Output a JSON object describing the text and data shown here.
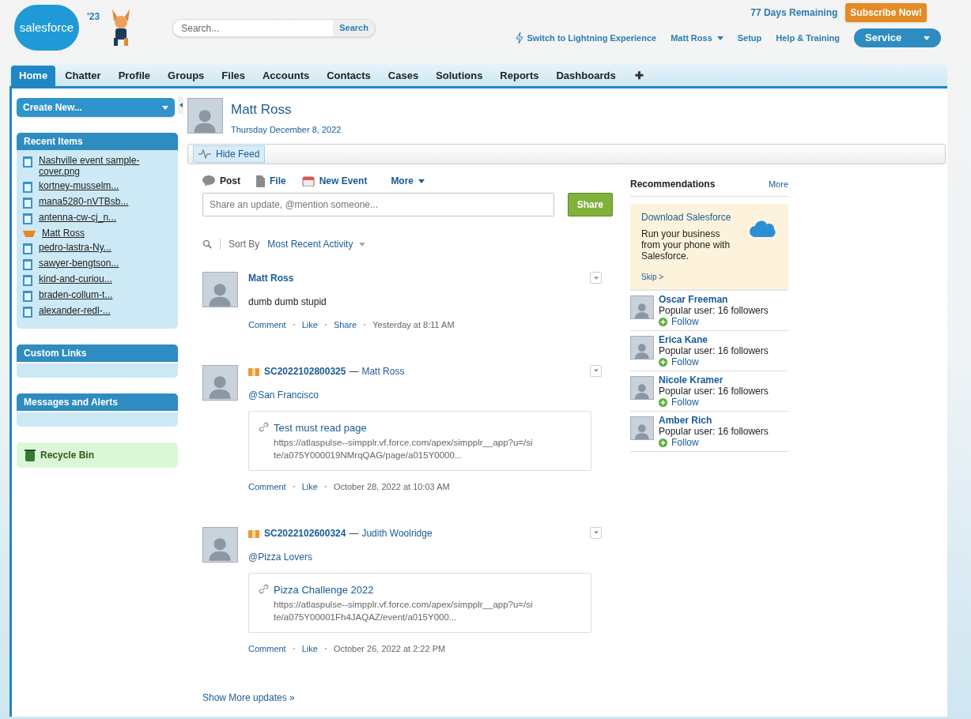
{
  "header": {
    "logo": "salesforce",
    "year": "'23",
    "search_placeholder": "Search...",
    "search_button": "Search",
    "trial": "77 Days Remaining",
    "subscribe": "Subscribe Now!",
    "lightning": "Switch to Lightning Experience",
    "user_menu": "Matt Ross",
    "links": [
      "Setup",
      "Help & Training"
    ],
    "app_menu": "Service"
  },
  "tabs": [
    {
      "label": "Home",
      "selected": true
    },
    {
      "label": "Chatter",
      "selected": false
    },
    {
      "label": "Profile",
      "selected": false
    },
    {
      "label": "Groups",
      "selected": false
    },
    {
      "label": "Files",
      "selected": false
    },
    {
      "label": "Accounts",
      "selected": false
    },
    {
      "label": "Contacts",
      "selected": false
    },
    {
      "label": "Cases",
      "selected": false
    },
    {
      "label": "Solutions",
      "selected": false
    },
    {
      "label": "Reports",
      "selected": false
    },
    {
      "label": "Dashboards",
      "selected": false
    }
  ],
  "add_tab": "✚",
  "sidebar": {
    "create_new": "Create New...",
    "recent_title": "Recent Items",
    "recent_items": [
      {
        "label": "Nashville event sample-cover.png",
        "kind": "file"
      },
      {
        "label": "kortney-musselm...",
        "kind": "file"
      },
      {
        "label": "mana5280-nVTBsb...",
        "kind": "file"
      },
      {
        "label": "antenna-cw-cj_n...",
        "kind": "file"
      },
      {
        "label": "Matt Ross",
        "kind": "user"
      },
      {
        "label": "pedro-lastra-Ny...",
        "kind": "file"
      },
      {
        "label": "sawyer-bengtson...",
        "kind": "file"
      },
      {
        "label": "kind-and-curiou...",
        "kind": "file"
      },
      {
        "label": "braden-collum-t...",
        "kind": "file"
      },
      {
        "label": "alexander-redl-...",
        "kind": "file"
      }
    ],
    "custom_links_title": "Custom Links",
    "messages_title": "Messages and Alerts",
    "recycle_bin": "Recycle Bin"
  },
  "profile": {
    "name": "Matt Ross",
    "date": "Thursday December 8, 2022",
    "hide_feed": "Hide Feed"
  },
  "publisher": {
    "actions": [
      {
        "label": "Post",
        "kind": "post",
        "selected": true
      },
      {
        "label": "File",
        "kind": "file",
        "selected": false
      },
      {
        "label": "New Event",
        "kind": "event",
        "selected": false
      }
    ],
    "more": "More",
    "placeholder": "Share an update, @mention someone...",
    "share": "Share"
  },
  "sort": {
    "label": "Sort By",
    "value": "Most Recent Activity"
  },
  "posts": [
    {
      "author": "Matt Ross",
      "text": "dumb dumb stupid",
      "actions": [
        "Comment",
        "Like",
        "Share"
      ],
      "time": "Yesterday at 8:11 AM"
    },
    {
      "record": "SC2022102800325",
      "author": "Matt Ross",
      "text": "@San Francisco",
      "link": {
        "title": "Test must read page",
        "url": "https://atlaspulse--simpplr.vf.force.com/apex/simpplr__app?u=/site/a075Y000019NMrqQAG/page/a015Y0000..."
      },
      "actions": [
        "Comment",
        "Like"
      ],
      "time": "October 28, 2022 at 10:03 AM"
    },
    {
      "record": "SC2022102600324",
      "author": "Judith Woolridge",
      "text": "@Pizza Lovers",
      "link": {
        "title": "Pizza Challenge 2022",
        "url": "https://atlaspulse--simpplr.vf.force.com/apex/simpplr__app?u=/site/a075Y00001Fh4JAQAZ/event/a015Y000..."
      },
      "actions": [
        "Comment",
        "Like"
      ],
      "time": "October 26, 2022 at 2:22 PM"
    }
  ],
  "record_separator": "—",
  "show_more": "Show More updates »",
  "recommendations": {
    "title": "Recommendations",
    "more": "More",
    "promo": {
      "title": "Download Salesforce",
      "body": "Run your business from your phone with Salesforce.",
      "skip": "Skip >"
    },
    "users": [
      {
        "name": "Oscar Freeman",
        "info": "Popular user: 16 followers",
        "follow": "Follow"
      },
      {
        "name": "Erica Kane",
        "info": "Popular user: 16 followers",
        "follow": "Follow"
      },
      {
        "name": "Nicole Kramer",
        "info": "Popular user: 16 followers",
        "follow": "Follow"
      },
      {
        "name": "Amber Rich",
        "info": "Popular user: 16 followers",
        "follow": "Follow"
      }
    ]
  }
}
